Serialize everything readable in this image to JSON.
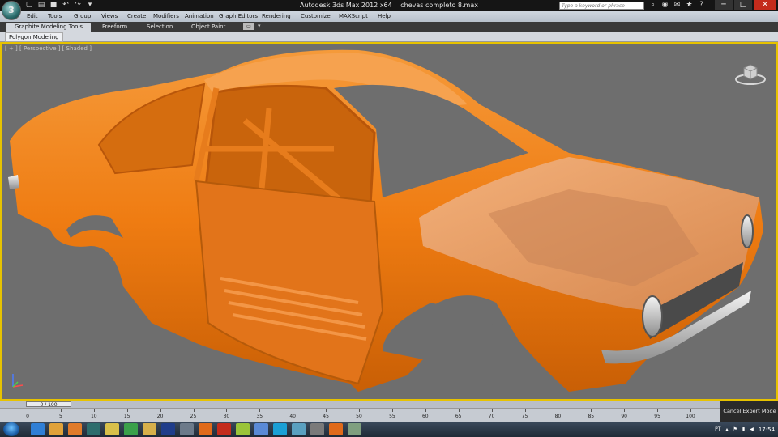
{
  "titlebar": {
    "app_name": "Autodesk 3ds Max  2012 x64",
    "file_name": "chevas completo 8.max",
    "search_placeholder": "Type a keyword or phrase",
    "logo_icon": "3dsmax-logo-icon",
    "quick_access": [
      "new-icon",
      "open-icon",
      "save-icon",
      "undo-icon",
      "redo-icon",
      "hold-icon"
    ],
    "tools": [
      "search-icon",
      "subscription-icon",
      "communication-icon",
      "favorites-icon",
      "help-icon"
    ],
    "window_buttons": [
      "─",
      "□",
      "✕"
    ]
  },
  "menu": [
    "Edit",
    "Tools",
    "Group",
    "Views",
    "Create",
    "Modifiers",
    "Animation",
    "Graph Editors",
    "Rendering",
    "Customize",
    "MAXScript",
    "Help"
  ],
  "ribbon": {
    "tabs": [
      "Graphite Modeling Tools",
      "Freeform",
      "Selection",
      "Object Paint"
    ],
    "active_tab": "Graphite Modeling Tools",
    "sub_tab": "Polygon Modeling"
  },
  "viewport": {
    "label": "[ + ] [ Perspective ] [ Shaded ]",
    "colors": {
      "body": "#f07d14",
      "background": "#6e6e6e",
      "active_border": "#e6c200"
    }
  },
  "timeline": {
    "slider_text": "0 / 100",
    "ticks": [
      "0",
      "5",
      "10",
      "15",
      "20",
      "25",
      "30",
      "35",
      "40",
      "45",
      "50",
      "55",
      "60",
      "65",
      "70",
      "75",
      "80",
      "85",
      "90",
      "95",
      "100"
    ]
  },
  "status": {
    "expert_mode_button": "Cancel Expert Mode"
  },
  "taskbar": {
    "apps": [
      "ie-icon",
      "folder-icon",
      "media-icon",
      "3dsmax-icon",
      "paint-icon",
      "chrome-icon",
      "folder2-icon",
      "photoshop-icon",
      "calc-icon",
      "firefox-icon",
      "opera-icon",
      "tool-icon",
      "explorer-icon",
      "skype-icon",
      "app-icon",
      "app2-icon",
      "firefox2-icon",
      "screen-icon"
    ],
    "language": "PT",
    "time": "17:54"
  }
}
